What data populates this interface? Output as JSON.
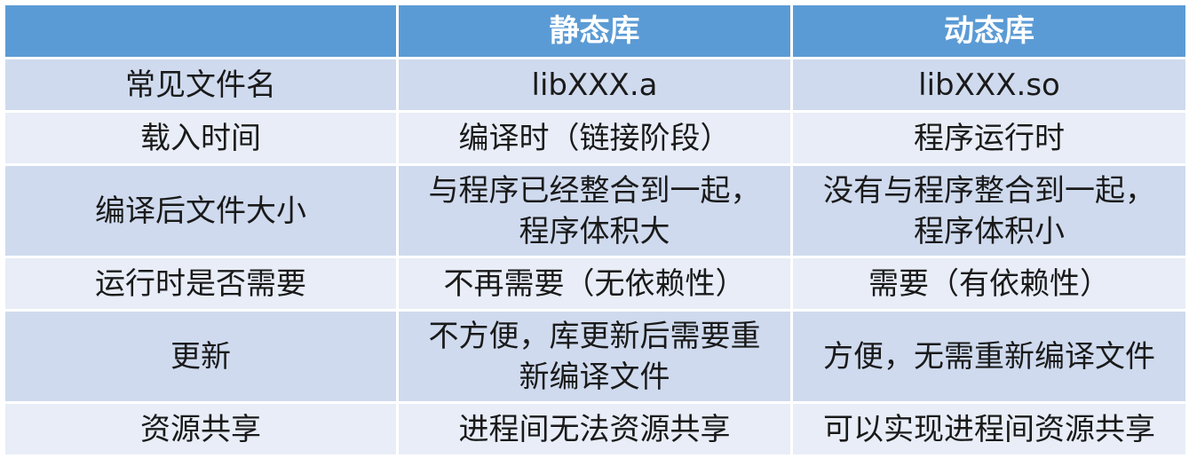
{
  "table": {
    "headers": [
      "",
      "静态库",
      "动态库"
    ],
    "rows": [
      {
        "label": "常见文件名",
        "static": [
          "libXXX.a"
        ],
        "dynamic": [
          "libXXX.so"
        ]
      },
      {
        "label": "载入时间",
        "static": [
          "编译时（链接阶段）"
        ],
        "dynamic": [
          "程序运行时"
        ]
      },
      {
        "label": "编译后文件大小",
        "static": [
          "与程序已经整合到一起，",
          "程序体积大"
        ],
        "dynamic": [
          "没有与程序整合到一起，",
          "程序体积小"
        ]
      },
      {
        "label": "运行时是否需要",
        "static": [
          "不再需要（无依赖性）"
        ],
        "dynamic": [
          "需要（有依赖性）"
        ]
      },
      {
        "label": "更新",
        "static": [
          "不方便，库更新后需要重",
          "新编译文件"
        ],
        "dynamic": [
          "方便，无需重新编译文件"
        ]
      },
      {
        "label": "资源共享",
        "static": [
          "进程间无法资源共享"
        ],
        "dynamic": [
          "可以实现进程间资源共享"
        ]
      }
    ]
  },
  "colors": {
    "header_bg": "#5b9bd5",
    "header_text": "#ffffff",
    "row_odd_bg": "#cfdaee",
    "row_even_bg": "#e8edf7"
  }
}
